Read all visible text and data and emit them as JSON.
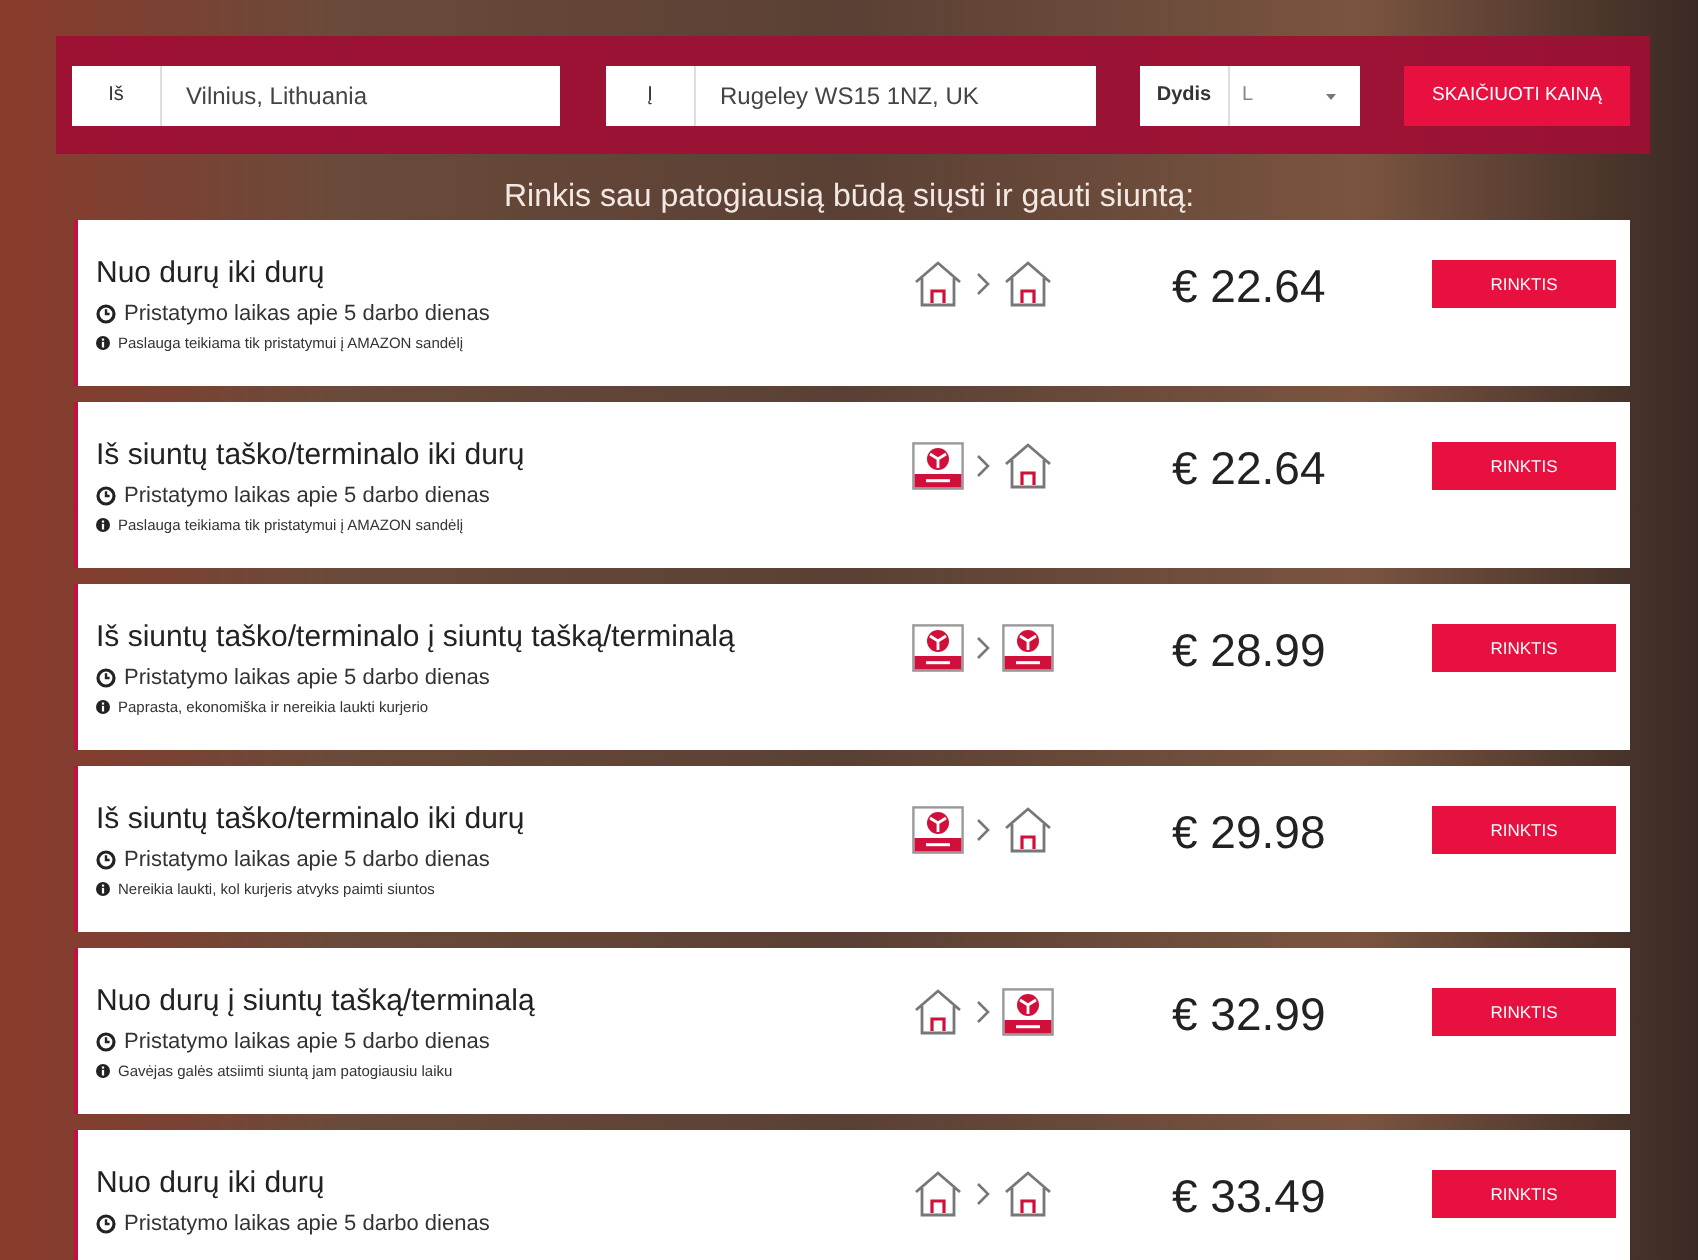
{
  "search_form": {
    "from": {
      "label": "Iš",
      "value": "Vilnius, Lithuania"
    },
    "to": {
      "label": "Į",
      "value": "Rugeley WS15 1NZ, UK"
    },
    "size": {
      "label": "Dydis",
      "value": "L"
    },
    "submit": "SKAIČIUOTI KAINĄ"
  },
  "heading": "Rinkis sau patogiausią būdą siųsti ir gauti siuntą:",
  "options": [
    {
      "title": "Nuo durų iki durų",
      "route": [
        {
          "kind": "home"
        },
        {
          "kind": "home"
        }
      ],
      "delivery": "Pristatymo laikas apie 5 darbo dienas",
      "note": "Paslauga teikiama tik pristatymui į AMAZON sandėlį",
      "price": "€ 22.64",
      "button": "RINKTIS"
    },
    {
      "title": "Iš siuntų taško/terminalo iki durų",
      "route": [
        {
          "kind": "terminal"
        },
        {
          "kind": "home"
        }
      ],
      "delivery": "Pristatymo laikas apie 5 darbo dienas",
      "note": "Paslauga teikiama tik pristatymui į AMAZON sandėlį",
      "price": "€ 22.64",
      "button": "RINKTIS"
    },
    {
      "title": "Iš siuntų taško/terminalo į siuntų tašką/terminalą",
      "route": [
        {
          "kind": "terminal"
        },
        {
          "kind": "terminal"
        }
      ],
      "delivery": "Pristatymo laikas apie 5 darbo dienas",
      "note": "Paprasta, ekonomiška ir nereikia laukti kurjerio",
      "price": "€ 28.99",
      "button": "RINKTIS"
    },
    {
      "title": "Iš siuntų taško/terminalo iki durų",
      "route": [
        {
          "kind": "terminal"
        },
        {
          "kind": "home"
        }
      ],
      "delivery": "Pristatymo laikas apie 5 darbo dienas",
      "note": "Nereikia laukti, kol kurjeris atvyks paimti siuntos",
      "price": "€ 29.98",
      "button": "RINKTIS"
    },
    {
      "title": "Nuo durų į siuntų tašką/terminalą",
      "route": [
        {
          "kind": "home"
        },
        {
          "kind": "terminal"
        }
      ],
      "delivery": "Pristatymo laikas apie 5 darbo dienas",
      "note": "Gavėjas galės atsiimti siuntą jam patogiausiu laiku",
      "price": "€ 32.99",
      "button": "RINKTIS"
    },
    {
      "title": "Nuo durų iki durų",
      "route": [
        {
          "kind": "home"
        },
        {
          "kind": "home"
        }
      ],
      "delivery": "Pristatymo laikas apie 5 darbo dienas",
      "price": "€ 33.49",
      "button": "RINKTIS"
    }
  ]
}
